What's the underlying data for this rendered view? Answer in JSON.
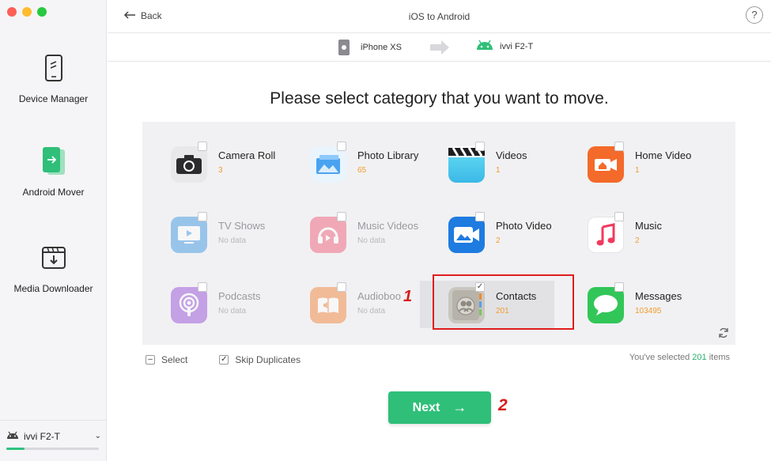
{
  "sidebar": {
    "items": [
      {
        "label": "Device Manager",
        "icon": "phone-icon"
      },
      {
        "label": "Android Mover",
        "icon": "android-mover-icon"
      },
      {
        "label": "Media Downloader",
        "icon": "download-icon"
      }
    ],
    "device": {
      "name": "ivvi F2-T",
      "storage_fraction": 0.2
    }
  },
  "header": {
    "back_label": "Back",
    "title": "iOS to Android",
    "help_label": "?"
  },
  "devices": {
    "source": "iPhone XS",
    "target": "ivvi F2-T"
  },
  "heading": "Please select category that you want to move.",
  "categories": [
    {
      "name": "Camera Roll",
      "count": "3",
      "enabled": true,
      "checked": false,
      "icon": "camera-icon"
    },
    {
      "name": "Photo Library",
      "count": "65",
      "enabled": true,
      "checked": false,
      "icon": "photo-library-icon"
    },
    {
      "name": "Videos",
      "count": "1",
      "enabled": true,
      "checked": false,
      "icon": "clapper-icon"
    },
    {
      "name": "Home Video",
      "count": "1",
      "enabled": true,
      "checked": false,
      "icon": "home-video-icon"
    },
    {
      "name": "TV Shows",
      "count": "No data",
      "enabled": false,
      "checked": false,
      "icon": "tv-icon"
    },
    {
      "name": "Music Videos",
      "count": "No data",
      "enabled": false,
      "checked": false,
      "icon": "music-video-icon"
    },
    {
      "name": "Photo Video",
      "count": "2",
      "enabled": true,
      "checked": false,
      "icon": "photo-video-icon"
    },
    {
      "name": "Music",
      "count": "2",
      "enabled": true,
      "checked": false,
      "icon": "music-note-icon"
    },
    {
      "name": "Podcasts",
      "count": "No data",
      "enabled": false,
      "checked": false,
      "icon": "podcast-icon"
    },
    {
      "name": "Audioboo",
      "count": "No data",
      "enabled": false,
      "checked": false,
      "icon": "audiobook-icon"
    },
    {
      "name": "Contacts",
      "count": "201",
      "enabled": true,
      "checked": true,
      "icon": "contacts-icon"
    },
    {
      "name": "Messages",
      "count": "103495",
      "enabled": true,
      "checked": false,
      "icon": "message-icon"
    }
  ],
  "annotations": {
    "step1": "1",
    "step2": "2"
  },
  "options": {
    "select_label": "Select",
    "skip_label": "Skip Duplicates",
    "skip_checked": true
  },
  "selection": {
    "prefix": "You've selected",
    "count": "201",
    "suffix": "items"
  },
  "next_label": "Next",
  "colors": {
    "accent": "#2fbf79",
    "count": "#f39c2f",
    "highlight": "#e01d1d"
  }
}
